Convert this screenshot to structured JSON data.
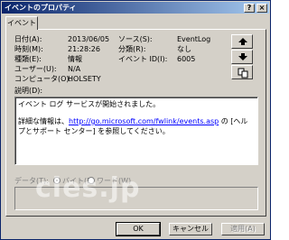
{
  "window": {
    "title": "イベントのプロパティ",
    "help_glyph": "?",
    "close_glyph": "×"
  },
  "tab": {
    "label": "イベント"
  },
  "fields": {
    "date_label": "日付(A):",
    "date_value": "2013/06/05",
    "time_label": "時刻(M):",
    "time_value": "21:28:26",
    "type_label": "種類(E):",
    "type_value": "情報",
    "user_label": "ユーザー(U):",
    "user_value": "N/A",
    "computer_label": "コンピュータ(O):",
    "computer_value": "HOLSETY",
    "source_label": "ソース(S):",
    "source_value": "EventLog",
    "category_label": "分類(R):",
    "category_value": "なし",
    "event_id_label": "イベント ID(I):",
    "event_id_value": "6005"
  },
  "description": {
    "label": "説明(D):",
    "line1": "イベント ログ サービスが開始されました。",
    "line2_prefix": "詳細な情報は、",
    "link": "http://go.microsoft.com/fwlink/events.asp",
    "line2_suffix": " の [ヘルプとサポート センター] を参照してください。"
  },
  "data": {
    "label": "データ(T):",
    "bytes_label": "バイト(B)",
    "words_label": "ワード(W)"
  },
  "buttons": {
    "ok": "OK",
    "cancel": "キャンセル",
    "apply": "適用(A)"
  },
  "watermark": "cles.jp"
}
